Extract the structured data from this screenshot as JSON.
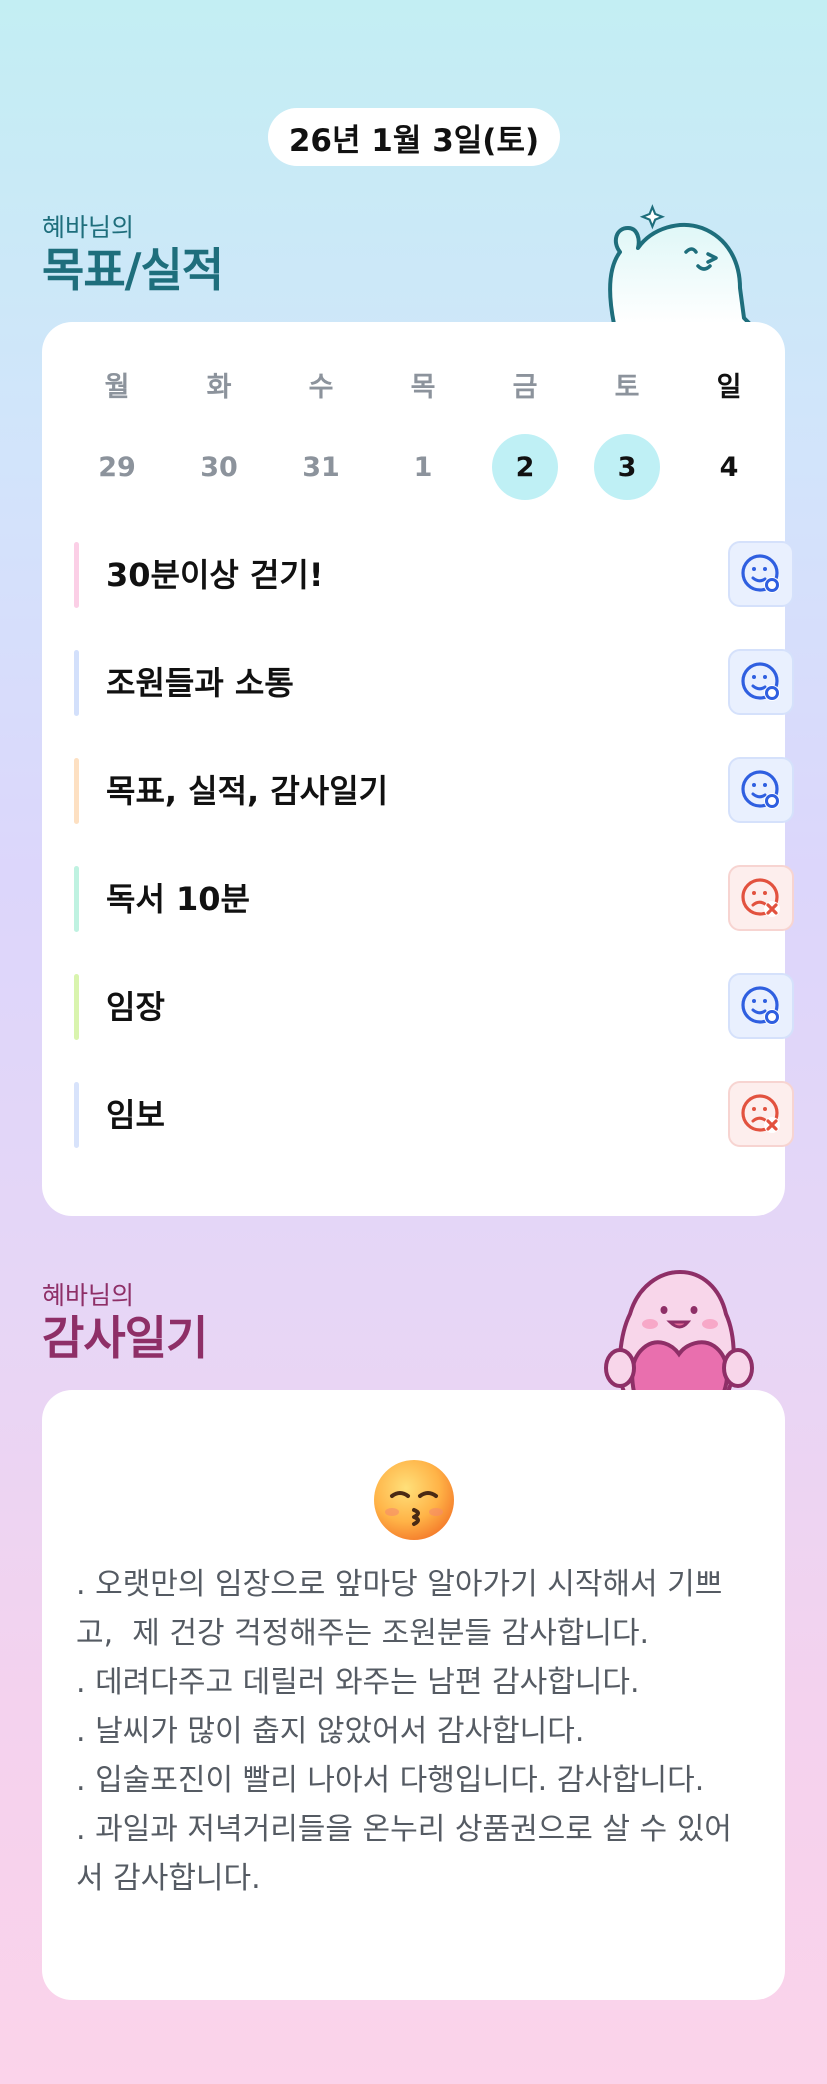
{
  "header": {
    "date": "26년 1월 3일(토)"
  },
  "goals_section": {
    "subtitle": "혜바님의",
    "title": "목표/실적"
  },
  "week": [
    {
      "name": "월",
      "num": "29",
      "active": false,
      "sunday": false
    },
    {
      "name": "화",
      "num": "30",
      "active": false,
      "sunday": false
    },
    {
      "name": "수",
      "num": "31",
      "active": false,
      "sunday": false
    },
    {
      "name": "목",
      "num": "1",
      "active": false,
      "sunday": false
    },
    {
      "name": "금",
      "num": "2",
      "active": true,
      "sunday": false
    },
    {
      "name": "토",
      "num": "3",
      "active": true,
      "sunday": false
    },
    {
      "name": "일",
      "num": "4",
      "active": false,
      "sunday": true
    }
  ],
  "tasks": [
    {
      "label": "30분이상 걷기!",
      "color": "#fbcfe6",
      "status": "done",
      "status_icon": "smile-check-icon"
    },
    {
      "label": "조원들과 소통",
      "color": "#d3e0fb",
      "status": "done",
      "status_icon": "smile-check-icon"
    },
    {
      "label": "목표, 실적, 감사일기",
      "color": "#fde0c2",
      "status": "done",
      "status_icon": "smile-check-icon"
    },
    {
      "label": "독서 10분",
      "color": "#bff2e1",
      "status": "missed",
      "status_icon": "sad-x-icon"
    },
    {
      "label": "임장",
      "color": "#d9f4ae",
      "status": "done",
      "status_icon": "smile-check-icon"
    },
    {
      "label": "임보",
      "color": "#d8e3fb",
      "status": "missed",
      "status_icon": "sad-x-icon"
    }
  ],
  "diary_section": {
    "subtitle": "혜바님의",
    "title": "감사일기"
  },
  "diary": {
    "emoji": "kissing-face-icon",
    "text": ". 오랫만의 임장으로 앞마당 알아가기 시작해서 기쁘고,  제 건강 걱정해주는 조원분들 감사합니다.\n. 데려다주고 데릴러 와주는 남편 감사합니다.\n. 날씨가 많이 춥지 않았어서 감사합니다.\n. 입술포진이 빨리 나아서 다행입니다. 감사합니다.\n. 과일과 저녁거리들을 온누리 상품권으로 살 수 있어서 감사합니다."
  },
  "colors": {
    "accent_teal": "#1e6e7c",
    "accent_plum": "#8e2f67",
    "active_day": "#bff0f5",
    "done_icon": "#2f5fe0",
    "missed_icon": "#e2523f"
  }
}
